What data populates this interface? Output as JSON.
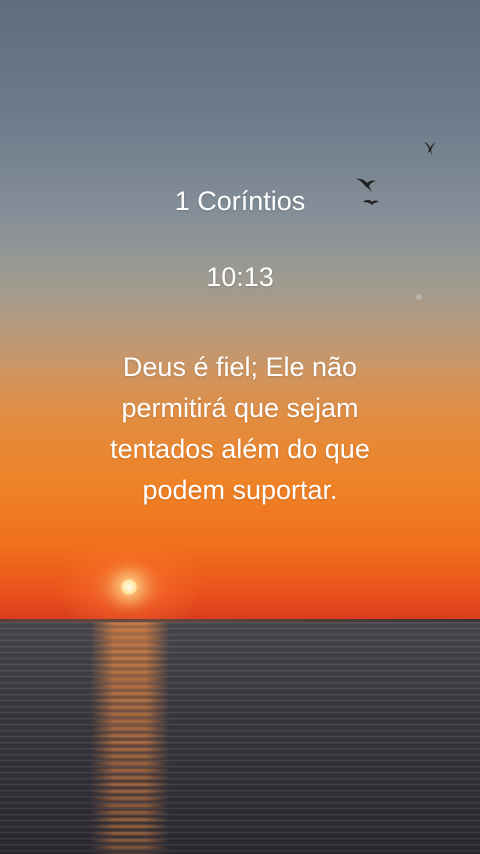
{
  "wallpaper": {
    "book": "1 Coríntios",
    "reference": "10:13",
    "verse": "Deus é fiel; Ele não permitirá que sejam tentados além do que podem suportar."
  },
  "scene": {
    "sky_top_color": "#5f6d7f",
    "sky_horizon_color": "#e84e1b",
    "sea_color": "#3b3a42",
    "sun_color": "#fffdf0"
  }
}
